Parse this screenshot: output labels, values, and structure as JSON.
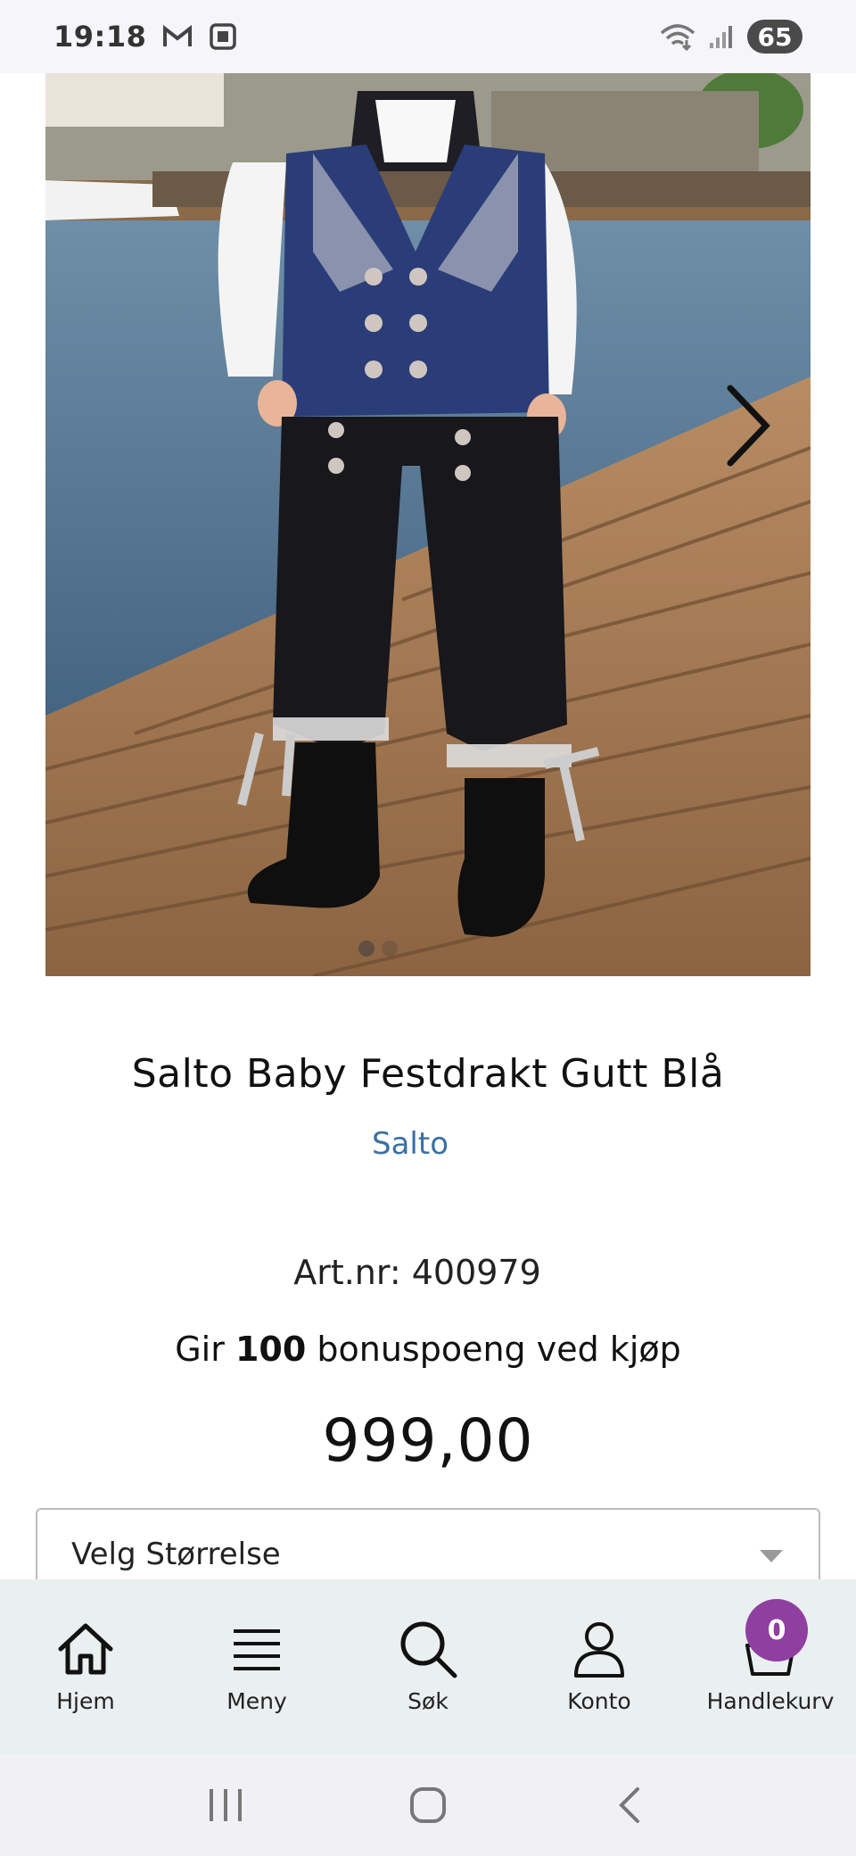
{
  "status_bar": {
    "time": "19:18",
    "battery": "65",
    "icons": [
      "gmail-icon",
      "screenshot-icon",
      "wifi-icon",
      "signal-icon"
    ]
  },
  "product": {
    "image_alt": "Salto Baby Festdrakt Gutt Blå",
    "image_count": 2,
    "active_image_index": 0,
    "title": "Salto Baby Festdrakt Gutt Blå",
    "brand": "Salto",
    "art_nr_label": "Art.nr: 400979",
    "bonus_prefix": "Gir",
    "bonus_points": "100",
    "bonus_suffix": "bonuspoeng ved kjøp",
    "price": "999,00",
    "size_select_placeholder": "Velg Størrelse"
  },
  "bottom_nav": {
    "items": [
      {
        "label": "Hjem",
        "icon": "home-icon"
      },
      {
        "label": "Meny",
        "icon": "menu-icon"
      },
      {
        "label": "Søk",
        "icon": "search-icon"
      },
      {
        "label": "Konto",
        "icon": "user-icon"
      },
      {
        "label": "Handlekurv",
        "icon": "basket-icon"
      }
    ],
    "cart_count": "0"
  },
  "colors": {
    "brand_link": "#3b6fa3",
    "cart_badge": "#8f3fa0",
    "nav_bg": "#eaeff0"
  }
}
